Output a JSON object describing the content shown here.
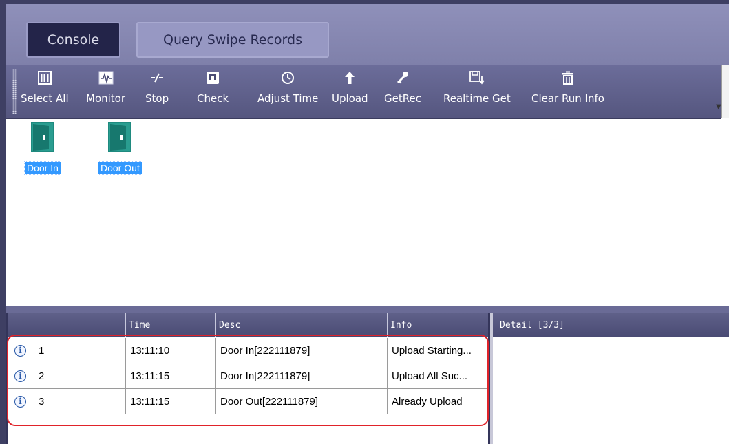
{
  "tabs": [
    {
      "label": "Console",
      "active": true
    },
    {
      "label": "Query Swipe Records",
      "active": false
    }
  ],
  "toolbar": [
    {
      "label": "Select All",
      "icon": "select-all-icon"
    },
    {
      "label": "Monitor",
      "icon": "monitor-icon"
    },
    {
      "label": "Stop",
      "icon": "stop-icon"
    },
    {
      "label": "Check",
      "icon": "check-icon"
    },
    {
      "label": "Adjust Time",
      "icon": "clock-icon"
    },
    {
      "label": "Upload",
      "icon": "upload-arrow-icon"
    },
    {
      "label": "GetRec",
      "icon": "key-icon"
    },
    {
      "label": "Realtime Get",
      "icon": "realtime-save-icon"
    },
    {
      "label": "Clear Run Info",
      "icon": "trash-icon"
    }
  ],
  "doors": [
    {
      "label": "Door In"
    },
    {
      "label": "Door Out"
    }
  ],
  "grid": {
    "columns": [
      "",
      "",
      "Time",
      "Desc",
      "Info"
    ],
    "rows": [
      {
        "no": "1",
        "time": "13:11:10",
        "desc": "Door In[222111879]",
        "info": "Upload Starting..."
      },
      {
        "no": "2",
        "time": "13:11:15",
        "desc": "Door In[222111879]",
        "info": "Upload All Suc..."
      },
      {
        "no": "3",
        "time": "13:11:15",
        "desc": "Door Out[222111879]",
        "info": "Already Upload"
      }
    ]
  },
  "detail": {
    "title": "Detail   [3/3]"
  },
  "colors": {
    "frame": "#3e3f63",
    "tabbar": "#8f90ba",
    "toolbar": "#616290",
    "header": "#55567f",
    "door": "#1f8a7f",
    "selection": "#3399ff",
    "highlight": "#e0232a"
  }
}
